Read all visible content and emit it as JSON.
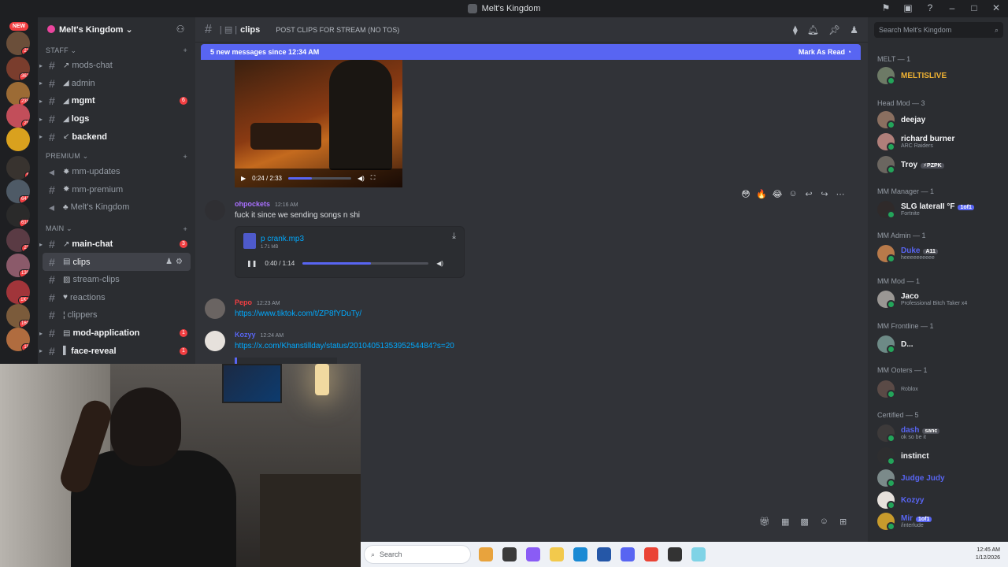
{
  "window": {
    "title": "Melt's Kingdom"
  },
  "server": {
    "name": "Melt's Kingdom ⌄",
    "new_label": "NEW"
  },
  "rail_badges": [
    "21",
    "362",
    "235",
    "29",
    "9",
    "642",
    "618",
    "23",
    "130",
    "1K+",
    "160",
    "18"
  ],
  "categories": {
    "staff": "STAFF ⌄",
    "premium": "PREMIUM ⌄",
    "main": "MAIN ⌄"
  },
  "channels": [
    {
      "name": "mods-chat",
      "unread": false,
      "badge": ""
    },
    {
      "name": "admin",
      "unread": false,
      "badge": ""
    },
    {
      "name": "mgmt",
      "unread": true,
      "badge": "6"
    },
    {
      "name": "logs",
      "unread": true,
      "badge": ""
    },
    {
      "name": "backend",
      "unread": true,
      "badge": ""
    },
    {
      "name": "mm-updates",
      "unread": false,
      "badge": ""
    },
    {
      "name": "mm-premium",
      "unread": false,
      "badge": ""
    },
    {
      "name": "Melt's Kingdom",
      "unread": false,
      "badge": ""
    },
    {
      "name": "main-chat",
      "unread": true,
      "badge": "3"
    },
    {
      "name": "clips",
      "unread": false,
      "badge": ""
    },
    {
      "name": "stream-clips",
      "unread": false,
      "badge": ""
    },
    {
      "name": "reactions",
      "unread": false,
      "badge": ""
    },
    {
      "name": "clippers",
      "unread": false,
      "badge": ""
    },
    {
      "name": "mod-application",
      "unread": true,
      "badge": "1"
    },
    {
      "name": "face-reveal",
      "unread": true,
      "badge": "1"
    }
  ],
  "chat": {
    "channel": "clips",
    "topic": "POST CLIPS FOR STREAM (NO TOS)",
    "new_messages": "5 new messages since 12:34 AM",
    "mark_read": "Mark As Read",
    "video_time": "0:24 / 2:33",
    "video_progress": 0.38,
    "messages": [
      {
        "author": "ohpockets",
        "time": "12:16 AM",
        "text": "fuck it since we sending songs n shi",
        "color": "#a970ff"
      },
      {
        "author": "Pepo",
        "time": "12:23 AM",
        "text": "https://www.tiktok.com/t/ZP8fYDuTy/",
        "color": "#f23f42"
      },
      {
        "author": "Kozyy",
        "time": "12:24 AM",
        "text": "https://x.com/Khanstillday/status/2010405135395254484?s=20",
        "color": "#5865f2"
      }
    ],
    "file": {
      "name": "p crank.mp3",
      "size": "1.71 MB",
      "time": "0:40 / 1:14",
      "progress": 0.54
    }
  },
  "search": {
    "placeholder": "Search Melt's Kingdom"
  },
  "members": {
    "groups": [
      {
        "label": "MELT — 1"
      },
      {
        "label": "Head Mod — 3"
      },
      {
        "label": "MM Manager — 1"
      },
      {
        "label": "MM Admin — 1"
      },
      {
        "label": "MM Mod — 1"
      },
      {
        "label": "MM Frontline — 1"
      },
      {
        "label": "MM Ooters — 1"
      },
      {
        "label": "Certified — 5"
      }
    ],
    "list": [
      {
        "name": "MELTISLIVE",
        "status": "",
        "color": "#f0b232",
        "tag": ""
      },
      {
        "name": "deejay",
        "status": "",
        "color": "#f2f3f5",
        "tag": ""
      },
      {
        "name": "richard burner",
        "status": "ARC Raiders",
        "color": "#f2f3f5",
        "tag": ""
      },
      {
        "name": "Troy",
        "status": "",
        "color": "#f2f3f5",
        "tag": "⚡PZPK"
      },
      {
        "name": "SLG lateraII °F",
        "status": "Fortnite",
        "color": "#f2f3f5",
        "tag": "1of1"
      },
      {
        "name": "Duke",
        "status": "heeeeeeeeee",
        "color": "#5865f2",
        "tag": "A11"
      },
      {
        "name": "Jaco",
        "status": "Professional Bitch Taker x4",
        "color": "#f2f3f5",
        "tag": ""
      },
      {
        "name": "D...",
        "status": "",
        "color": "#f2f3f5",
        "tag": ""
      },
      {
        "name": "",
        "status": "Roblox",
        "color": "#f2f3f5",
        "tag": ""
      },
      {
        "name": "dash",
        "status": "ok so be it",
        "color": "#5865f2",
        "tag": "sanc"
      },
      {
        "name": "instinct",
        "status": "",
        "color": "#f2f3f5",
        "tag": ""
      },
      {
        "name": "Judge Judy",
        "status": "",
        "color": "#5865f2",
        "tag": ""
      },
      {
        "name": "Kozyy",
        "status": "",
        "color": "#5865f2",
        "tag": ""
      },
      {
        "name": "Mir",
        "status": "/interlude",
        "color": "#5865f2",
        "tag": "1of1"
      }
    ]
  },
  "taskbar": {
    "search": "Search",
    "time": "12:45 AM",
    "date": "1/12/2026"
  }
}
